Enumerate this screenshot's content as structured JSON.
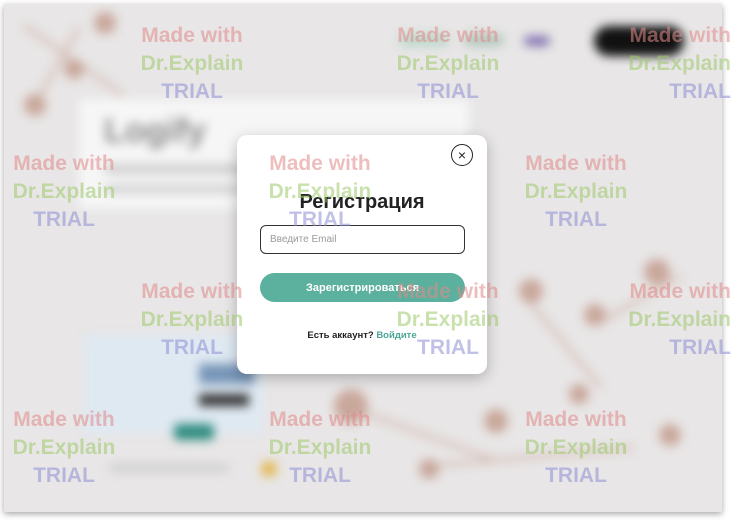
{
  "background_page": {
    "logo_text": "Logify"
  },
  "modal": {
    "title": "Регистрация",
    "email_placeholder": "Введите Email",
    "email_value": "",
    "register_label": "Зарегистрироваться",
    "close_glyph": "×",
    "have_account_text": "Есть аккаунт?",
    "login_link": "Войдите"
  },
  "watermark": {
    "line1": "Made with",
    "line2": "Dr.Explain",
    "line3": "TRIAL"
  },
  "colors": {
    "accent": "#5bb09e",
    "link": "#4aa595",
    "overlay_bg": "#e8e6e6"
  }
}
